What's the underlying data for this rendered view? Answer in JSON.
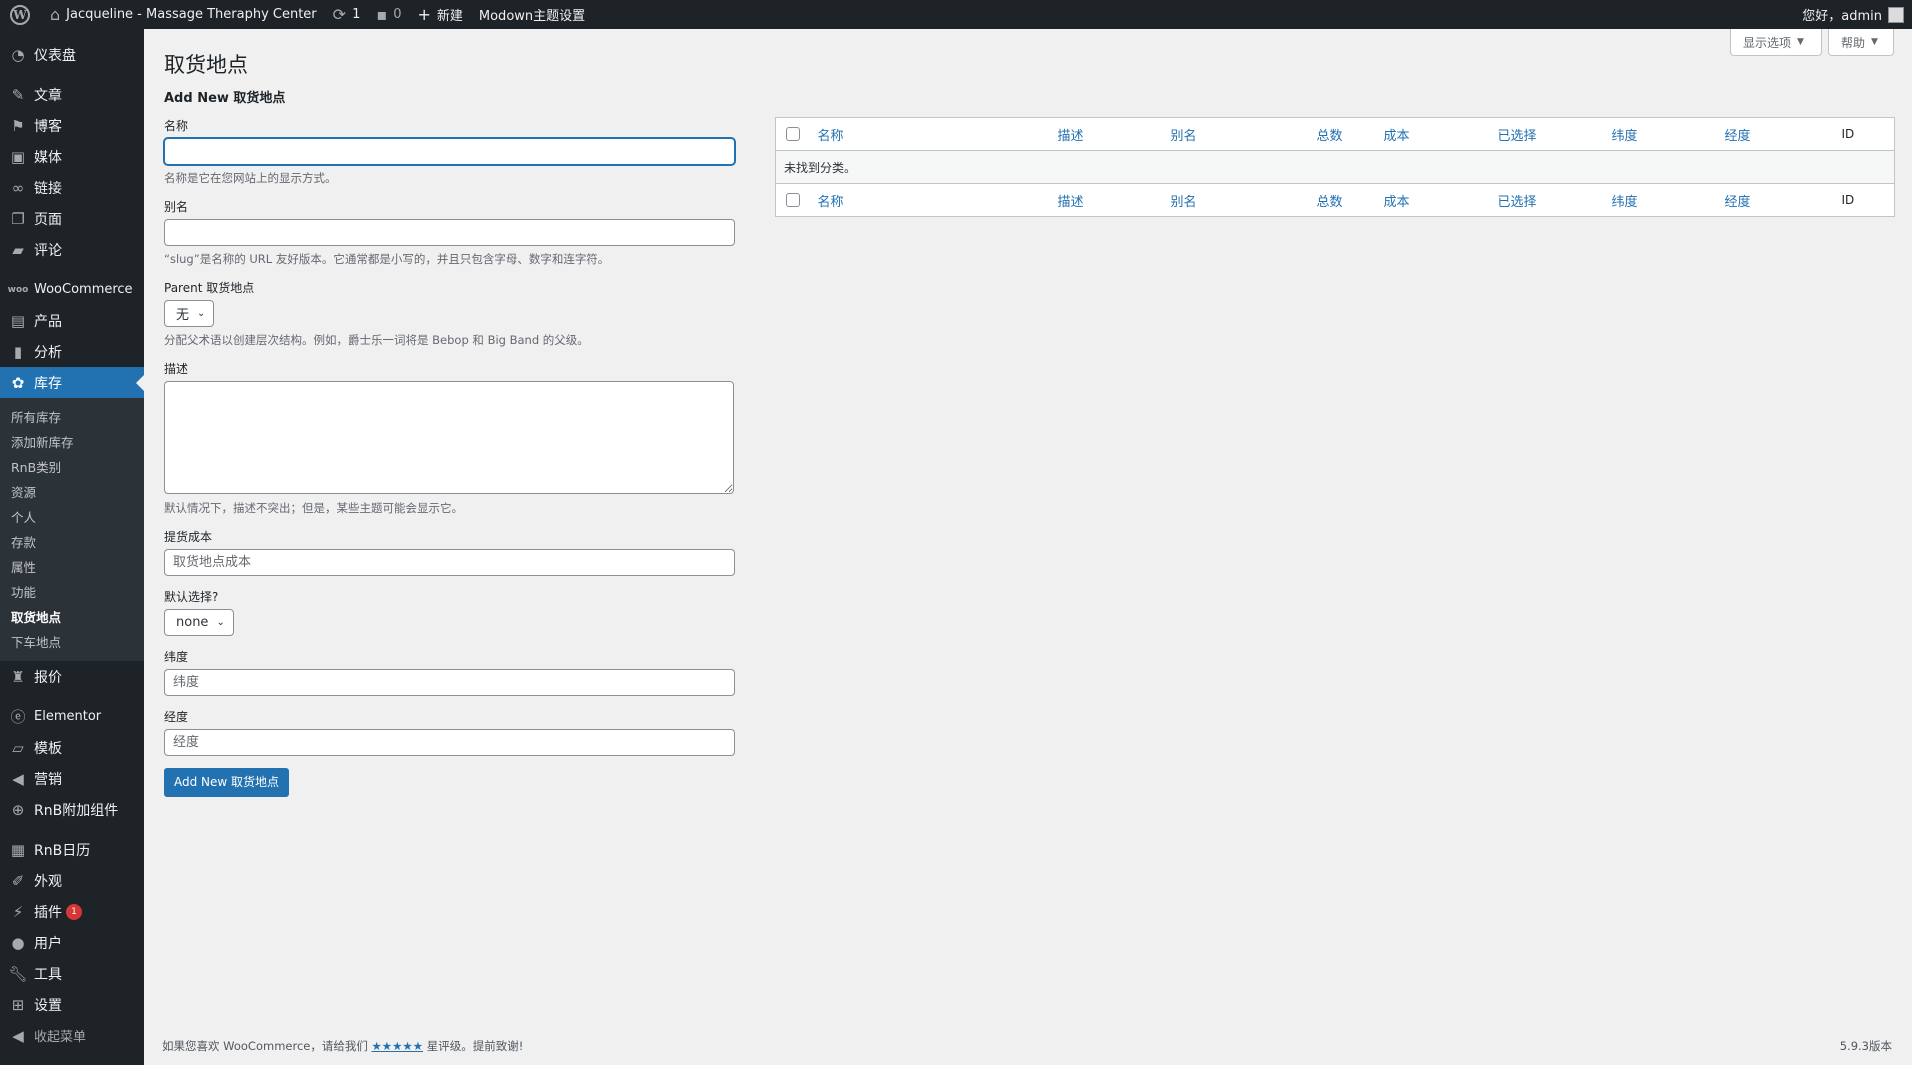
{
  "adminbar": {
    "site_name": "Jacqueline - Massage Theraphy Center",
    "updates_count": "1",
    "comments_count": "0",
    "new_label": "新建",
    "theme_settings": "Modown主题设置",
    "greeting": "您好，admin"
  },
  "sidebar": {
    "items": [
      {
        "label": "仪表盘",
        "icon": "dashboard-icon"
      },
      {
        "label": "文章",
        "icon": "pin-icon"
      },
      {
        "label": "博客",
        "icon": "flag-icon"
      },
      {
        "label": "媒体",
        "icon": "media-icon"
      },
      {
        "label": "链接",
        "icon": "link-icon"
      },
      {
        "label": "页面",
        "icon": "page-icon"
      },
      {
        "label": "评论",
        "icon": "comment-icon"
      },
      {
        "label": "WooCommerce",
        "icon": "woo-icon"
      },
      {
        "label": "产品",
        "icon": "archive-icon"
      },
      {
        "label": "分析",
        "icon": "chart-icon"
      },
      {
        "label": "库存",
        "icon": "inventory-icon"
      },
      {
        "label": "报价",
        "icon": "quote-icon"
      },
      {
        "label": "Elementor",
        "icon": "elementor-icon"
      },
      {
        "label": "模板",
        "icon": "folder-icon"
      },
      {
        "label": "营销",
        "icon": "megaphone-icon"
      },
      {
        "label": "RnB附加组件",
        "icon": "plus-circle-icon"
      },
      {
        "label": "RnB日历",
        "icon": "calendar-icon"
      },
      {
        "label": "外观",
        "icon": "brush-icon"
      },
      {
        "label": "插件",
        "icon": "plugin-icon"
      },
      {
        "label": "用户",
        "icon": "user-icon"
      },
      {
        "label": "工具",
        "icon": "wrench-icon"
      },
      {
        "label": "设置",
        "icon": "settings-icon"
      }
    ],
    "plugins_badge": "1",
    "submenu": [
      "所有库存",
      "添加新库存",
      "RnB类别",
      "资源",
      "个人",
      "存款",
      "属性",
      "功能",
      "取货地点",
      "下车地点"
    ],
    "collapse_label": "收起菜单"
  },
  "screen_options": "显示选项",
  "help": "帮助",
  "page_title": "取货地点",
  "form": {
    "title": "Add New 取货地点",
    "name_label": "名称",
    "name_value": "",
    "name_desc": "名称是它在您网站上的显示方式。",
    "slug_label": "别名",
    "slug_value": "",
    "slug_desc": "“slug”是名称的 URL 友好版本。它通常都是小写的，并且只包含字母、数字和连字符。",
    "parent_label": "Parent 取货地点",
    "parent_value": "无",
    "parent_desc": "分配父术语以创建层次结构。例如，爵士乐一词将是 Bebop 和 Big Band 的父级。",
    "description_label": "描述",
    "description_desc": "默认情况下，描述不突出；但是，某些主题可能会显示它。",
    "cost_label": "提货成本",
    "cost_placeholder": "取货地点成本",
    "default_label": "默认选择?",
    "default_value": "none",
    "lat_label": "纬度",
    "lat_placeholder": "纬度",
    "lng_label": "经度",
    "lng_placeholder": "经度",
    "submit_label": "Add New 取货地点"
  },
  "table": {
    "columns": [
      "名称",
      "描述",
      "别名",
      "总数",
      "成本",
      "已选择",
      "纬度",
      "经度",
      "ID"
    ],
    "empty_message": "未找到分类。"
  },
  "footer": {
    "thanks_prefix": "如果您喜欢 WooCommerce，请给我们",
    "stars": "★★★★★",
    "thanks_suffix": "星评级。提前致谢!",
    "version": "5.9.3版本"
  }
}
